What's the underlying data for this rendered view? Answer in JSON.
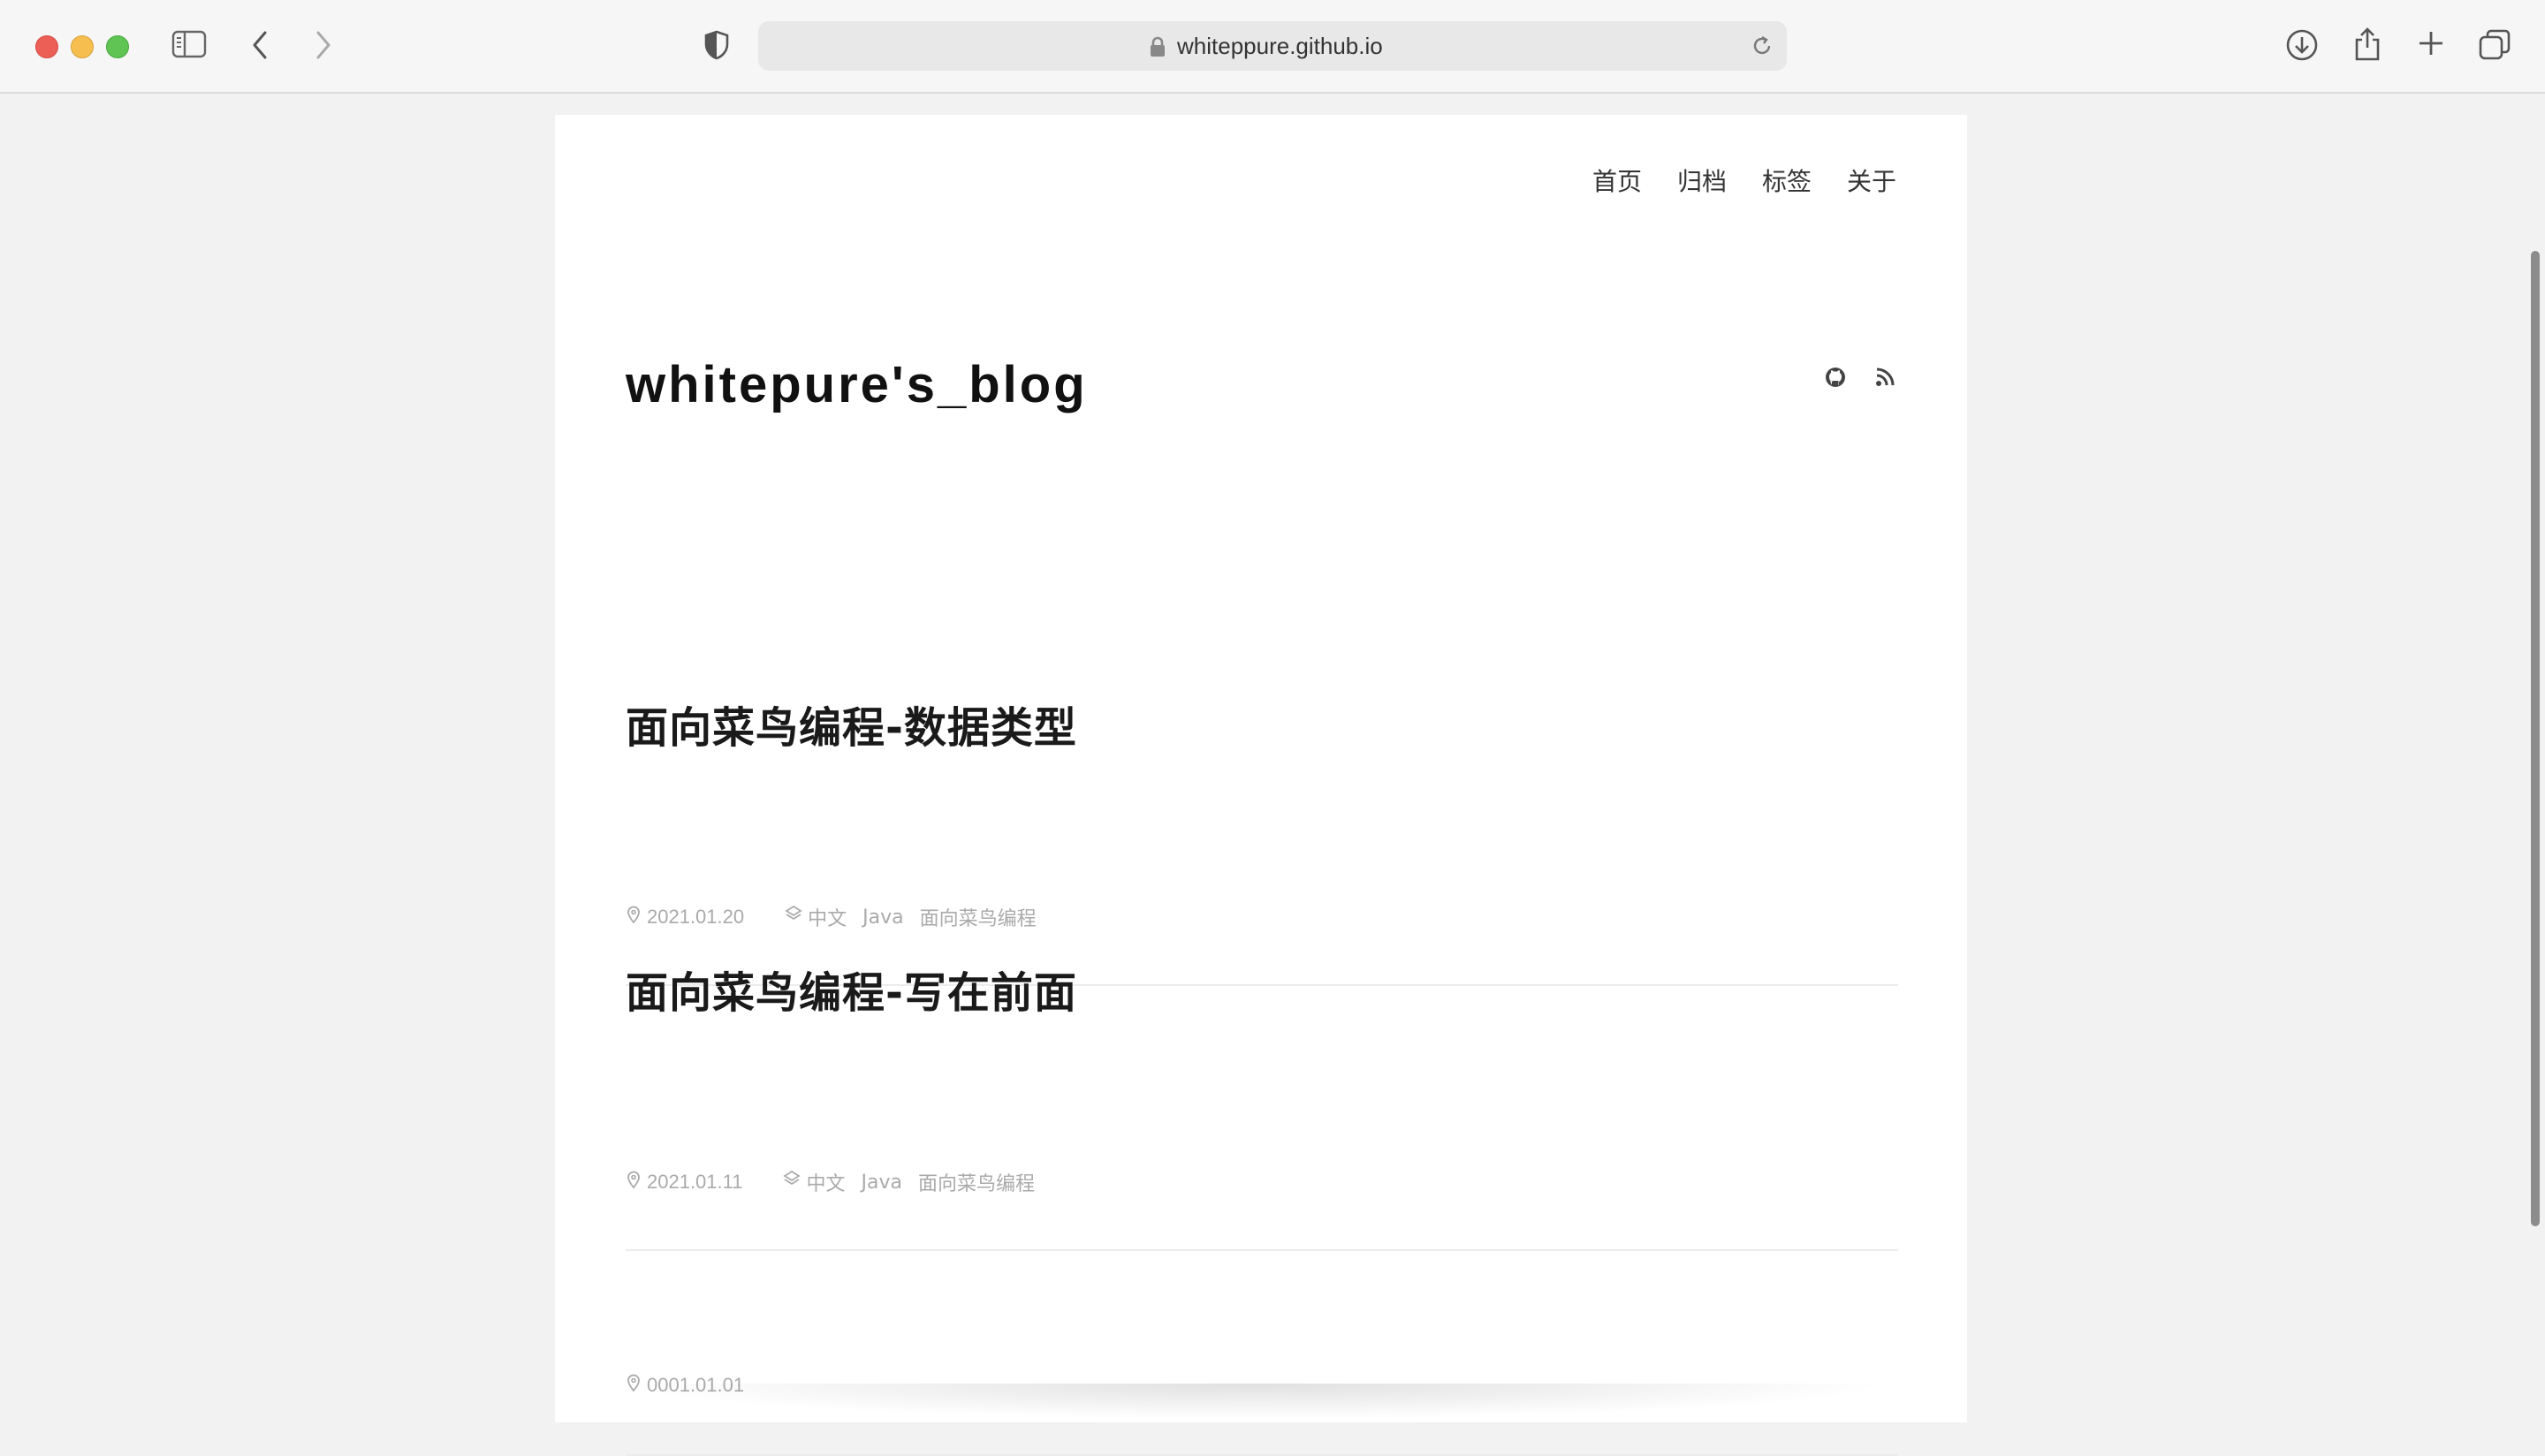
{
  "browser": {
    "url": "whiteppure.github.io"
  },
  "site": {
    "title": "whitepure's_blog",
    "nav": [
      "首页",
      "归档",
      "标签",
      "关于"
    ]
  },
  "posts": [
    {
      "title": "面向菜鸟编程-数据类型",
      "date": "2021.01.20",
      "tags": [
        "中文",
        "Java",
        "面向菜鸟编程"
      ]
    },
    {
      "title": "面向菜鸟编程-写在前面",
      "date": "2021.01.11",
      "tags": [
        "中文",
        "Java",
        "面向菜鸟编程"
      ]
    },
    {
      "title": "",
      "date": "0001.01.01",
      "tags": []
    }
  ],
  "icons": {
    "social": [
      "github-icon",
      "rss-icon"
    ],
    "date": "pin-icon",
    "tags": "layers-icon"
  },
  "colors": {
    "page_bg": "#f2f2f2",
    "card_bg": "#ffffff",
    "meta_text": "#aaaaaa"
  }
}
